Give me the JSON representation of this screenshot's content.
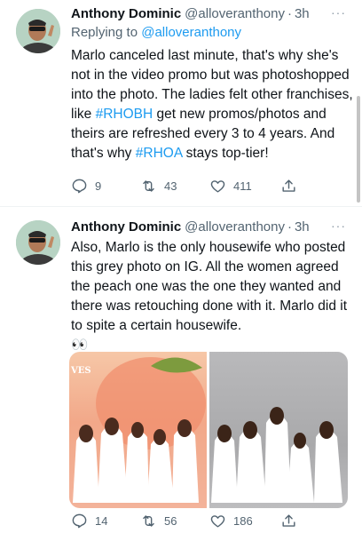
{
  "tweets": [
    {
      "author_name": "Anthony Dominic",
      "handle": "@alloveranthony",
      "separator": "·",
      "time": "3h",
      "more": "···",
      "replying_prefix": "Replying to ",
      "replying_to": "@alloveranthony",
      "text_parts": [
        "Marlo canceled last minute, that's why she's not in the video promo but was photoshopped into the photo. The ladies felt other franchises, like ",
        "#RHOBH",
        " get new promos/photos and theirs are refreshed every 3 to 4 years. And that's why ",
        "#RHOA",
        " stays top-tier!"
      ],
      "replies": "9",
      "retweets": "43",
      "likes": "411"
    },
    {
      "author_name": "Anthony Dominic",
      "handle": "@alloveranthony",
      "separator": "·",
      "time": "3h",
      "more": "···",
      "text": "Also, Marlo is the only housewife who posted this grey photo on IG. All the women agreed the peach one was the one they wanted and there was retouching done with it. Marlo did it to spite a certain housewife.",
      "emoji": "👀",
      "photo_logo": "VES",
      "replies": "14",
      "retweets": "56",
      "likes": "186"
    }
  ],
  "colors": {
    "link": "#1d9bf0",
    "secondary_text": "#536471",
    "primary_text": "#0f1419"
  },
  "icons": [
    "reply-icon",
    "retweet-icon",
    "like-icon",
    "share-icon",
    "more-icon"
  ]
}
